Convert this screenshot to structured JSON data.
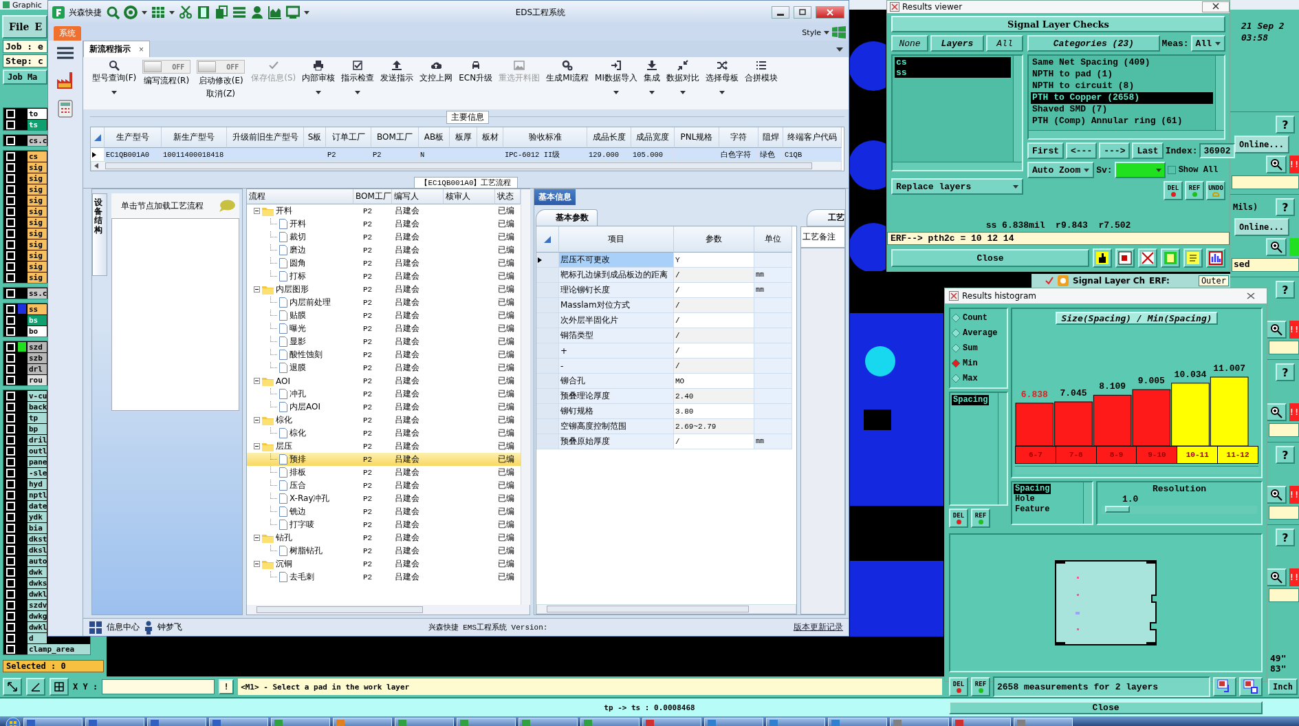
{
  "desktop": {
    "title": "Graphic",
    "menu": [
      "File",
      "E"
    ],
    "job": "Job : e",
    "step": "Step: c",
    "job_matrix": "Job Ma",
    "layer_groups": [
      {
        "layers": [
          {
            "name": "to",
            "color": "#ffffff",
            "checked": false
          },
          {
            "name": "ts",
            "color": "#10a070",
            "checked": false
          }
        ]
      },
      {
        "layers": [
          {
            "name": "cs.c",
            "color": "#c8c8c8",
            "checked": false
          }
        ]
      },
      {
        "layers": [
          {
            "name": "cs",
            "color": "#f8c060",
            "checked": false
          },
          {
            "name": "sig",
            "color": "#f8c060",
            "checked": false
          },
          {
            "name": "sig",
            "color": "#f8c060",
            "checked": false
          },
          {
            "name": "sig",
            "color": "#f8c060",
            "checked": false
          },
          {
            "name": "sig",
            "color": "#f8c060",
            "checked": false
          },
          {
            "name": "sig",
            "color": "#f8c060",
            "checked": false
          },
          {
            "name": "sig",
            "color": "#f8c060",
            "checked": false
          },
          {
            "name": "sig",
            "color": "#f8c060",
            "checked": false
          },
          {
            "name": "sig",
            "color": "#f8c060",
            "checked": false
          },
          {
            "name": "sig",
            "color": "#f8c060",
            "checked": false
          },
          {
            "name": "sig",
            "color": "#f8c060",
            "checked": false
          },
          {
            "name": "sig",
            "color": "#f8c060",
            "checked": false
          }
        ]
      },
      {
        "layers": [
          {
            "name": "ss.c",
            "color": "#c8c8c8",
            "checked": false
          }
        ]
      },
      {
        "layers": [
          {
            "name": "ss",
            "color": "#f8c060",
            "checked": false,
            "swatch": {
              "color": "#2030e0"
            }
          },
          {
            "name": "bs",
            "color": "#10a070",
            "checked": false
          },
          {
            "name": "bo",
            "color": "#ffffff",
            "checked": false
          }
        ]
      },
      {
        "layers": [
          {
            "name": "szd",
            "color": "#b8b8b8",
            "checked": false,
            "swatch": {
              "color": "#20e020"
            }
          },
          {
            "name": "szb",
            "color": "#b8b8b8",
            "checked": false
          },
          {
            "name": "drl",
            "color": "#b8b8b8",
            "checked": false
          },
          {
            "name": "rou",
            "color": "#e0e0e0",
            "checked": false
          }
        ]
      },
      {
        "layers": [
          {
            "name": "v-cu",
            "color": "#a8dcd4",
            "checked": false
          },
          {
            "name": "back",
            "color": "#a8dcd4",
            "checked": false
          },
          {
            "name": "tp",
            "color": "#a8dcd4",
            "checked": false
          },
          {
            "name": "bp",
            "color": "#a8dcd4",
            "checked": false
          },
          {
            "name": "dril",
            "color": "#a8dcd4",
            "checked": false
          },
          {
            "name": "outl",
            "color": "#a8dcd4",
            "checked": false
          },
          {
            "name": "pane",
            "color": "#a8dcd4",
            "checked": false
          },
          {
            "name": "-sle",
            "color": "#a8dcd4",
            "checked": false
          },
          {
            "name": "hyd",
            "color": "#a8dcd4",
            "checked": false
          },
          {
            "name": "nptl",
            "color": "#a8dcd4",
            "checked": false
          },
          {
            "name": "date",
            "color": "#a8dcd4",
            "checked": false
          },
          {
            "name": "ydk",
            "color": "#a8dcd4",
            "checked": false
          },
          {
            "name": "bia",
            "color": "#a8dcd4",
            "checked": false
          },
          {
            "name": "dkst",
            "color": "#a8dcd4",
            "checked": false
          },
          {
            "name": "dksl",
            "color": "#a8dcd4",
            "checked": false
          },
          {
            "name": "auto",
            "color": "#a8dcd4",
            "checked": false
          },
          {
            "name": "dwk",
            "color": "#a8dcd4",
            "checked": false
          },
          {
            "name": "dwks",
            "color": "#a8dcd4",
            "checked": false
          },
          {
            "name": "dwkl",
            "color": "#a8dcd4",
            "checked": false
          },
          {
            "name": "szdv",
            "color": "#a8dcd4",
            "checked": false
          },
          {
            "name": "dwkg",
            "color": "#a8dcd4",
            "checked": false
          },
          {
            "name": "dwkl",
            "color": "#a8dcd4",
            "checked": false
          },
          {
            "name": "d",
            "color": "#a8dcd4",
            "checked": false
          },
          {
            "name": "clamp_area",
            "color": "#a8dcd4",
            "checked": false
          }
        ]
      }
    ],
    "selected_count": "Selected : 0",
    "xy_label": "X Y :",
    "alert_button": "!",
    "prompt": "<M1> - Select a pad in the work layer",
    "units": "Inch",
    "status": "tp -> ts : 0.0008468",
    "clock": {
      "date": "21 Sep 2",
      "time": "03:58"
    },
    "check_blocks": [
      {
        "help": "?",
        "online": "Online...",
        "status": {
          "color": "#ff2020",
          "text": "!!"
        }
      },
      {
        "help": "?",
        "note": "Mils)",
        "online": "Online...",
        "status": {
          "color": "#20e020"
        },
        "field": "sed"
      },
      {
        "help": "?",
        "status": {
          "color": "#ff2020",
          "text": "!!"
        }
      },
      {
        "help": "?",
        "status": {
          "color": "#ff2020",
          "text": "!!"
        }
      },
      {
        "help": "?",
        "status": {
          "color": "#ff2020",
          "text": "!!"
        }
      },
      {
        "help": "?",
        "status": {
          "color": "#ff2020",
          "text": "!!"
        }
      }
    ],
    "coords": [
      "49\"",
      "83\""
    ],
    "behind_window": {
      "title": "Signal Layer Ch",
      "checked": true,
      "erf_label": "ERF:",
      "erf_value": "Outer"
    },
    "taskbar": [
      {
        "color": "#3060c0"
      },
      {
        "color": "#3060c0"
      },
      {
        "color": "#3060c0"
      },
      {
        "color": "#3060c0"
      },
      {
        "color": "#30a040"
      },
      {
        "color": "#e08020"
      },
      {
        "color": "#30a040"
      },
      {
        "color": "#30a040"
      },
      {
        "color": "#30a040"
      },
      {
        "color": "#30a040"
      },
      {
        "color": "#d03030"
      },
      {
        "color": "#3080d0"
      },
      {
        "color": "#3080d0"
      },
      {
        "color": "#3080d0"
      },
      {
        "color": "#808080"
      },
      {
        "color": "#d03030"
      },
      {
        "color": "#808080"
      }
    ]
  },
  "eds_window": {
    "app_name": "兴森快捷",
    "title": "EDS工程系统",
    "menu_tab": "系统",
    "style_label": "Style",
    "document_tab": {
      "label": "新流程指示",
      "close": "×"
    },
    "toolbar": [
      {
        "label": "型号查询(F)",
        "kind": "button",
        "dropdown": true,
        "disabled": false
      },
      {
        "label": "编写流程(R)",
        "kind": "toggle",
        "switch": "OFF",
        "on": false
      },
      {
        "label": "启动修改(E)",
        "sublabel": "取消(Z)",
        "kind": "toggle",
        "switch": "OFF",
        "on": false
      },
      {
        "label": "保存信息(S)",
        "kind": "button",
        "dropdown": false,
        "disabled": true
      },
      {
        "label": "内部审核",
        "kind": "button",
        "dropdown": true,
        "disabled": false
      },
      {
        "label": "指示检查",
        "kind": "button",
        "dropdown": true,
        "disabled": false
      },
      {
        "label": "发送指示",
        "kind": "button",
        "dropdown": false,
        "disabled": false
      },
      {
        "label": "文控上网",
        "kind": "button",
        "dropdown": false,
        "disabled": false
      },
      {
        "label": "ECN升级",
        "kind": "button",
        "dropdown": false,
        "disabled": false
      },
      {
        "label": "重选开料图",
        "kind": "button",
        "dropdown": false,
        "disabled": true
      },
      {
        "label": "生成MI流程",
        "kind": "button",
        "dropdown": false,
        "disabled": false
      },
      {
        "label": "MI数据导入",
        "kind": "button",
        "dropdown": true,
        "disabled": false
      },
      {
        "label": "集成",
        "kind": "button",
        "dropdown": true,
        "disabled": false
      },
      {
        "label": "数据对比",
        "kind": "button",
        "dropdown": true,
        "disabled": false
      },
      {
        "label": "选择母板",
        "kind": "button",
        "dropdown": true,
        "disabled": false
      },
      {
        "label": "合拼模块",
        "kind": "button",
        "dropdown": false,
        "disabled": false
      }
    ],
    "main_info": {
      "caption": "主要信息",
      "columns": [
        "生产型号",
        "新生产型号",
        "升级前旧生产型号",
        "S板",
        "订单工厂",
        "BOM工厂",
        "AB板",
        "板厚",
        "板材",
        "验收标准",
        "成品长度",
        "成品宽度",
        "PNL规格",
        "字符",
        "阻焊",
        "终端客户代码"
      ],
      "rows": [
        {
          "selected": true,
          "cells": [
            "EC1QB001A0",
            "10011400018418",
            null,
            null,
            "P2",
            "P2",
            "N",
            null,
            null,
            "IPC-6012 II级",
            "129.000",
            "105.000",
            null,
            "白色字符",
            "绿色",
            "C1QB"
          ]
        }
      ]
    },
    "process_caption": "【EC1QB001A0】工艺流程",
    "side_panel": {
      "tab": "设备结构",
      "hint": "单击节点加载工艺流程"
    },
    "process_tree": {
      "columns": [
        "流程",
        "BOM工厂",
        "编写人",
        "核审人",
        "状态"
      ],
      "rows": [
        {
          "label": "开料",
          "bom": "P2",
          "author": "吕建会",
          "status": "已编",
          "selected": false,
          "expanded": true,
          "children": [
            {
              "label": "开料",
              "bom": "P2",
              "author": "吕建会",
              "status": "已编",
              "selected": false
            },
            {
              "label": "裁切",
              "bom": "P2",
              "author": "吕建会",
              "status": "已编",
              "selected": false
            },
            {
              "label": "磨边",
              "bom": "P2",
              "author": "吕建会",
              "status": "已编",
              "selected": false
            },
            {
              "label": "圆角",
              "bom": "P2",
              "author": "吕建会",
              "status": "已编",
              "selected": false
            },
            {
              "label": "打标",
              "bom": "P2",
              "author": "吕建会",
              "status": "已编",
              "selected": false
            }
          ]
        },
        {
          "label": "内层图形",
          "bom": "P2",
          "author": "吕建会",
          "status": "已编",
          "selected": false,
          "expanded": true,
          "children": [
            {
              "label": "内层前处理",
              "bom": "P2",
              "author": "吕建会",
              "status": "已编",
              "selected": false
            },
            {
              "label": "贴膜",
              "bom": "P2",
              "author": "吕建会",
              "status": "已编",
              "selected": false
            },
            {
              "label": "曝光",
              "bom": "P2",
              "author": "吕建会",
              "status": "已编",
              "selected": false
            },
            {
              "label": "显影",
              "bom": "P2",
              "author": "吕建会",
              "status": "已编",
              "selected": false
            },
            {
              "label": "酸性蚀刻",
              "bom": "P2",
              "author": "吕建会",
              "status": "已编",
              "selected": false
            },
            {
              "label": "退膜",
              "bom": "P2",
              "author": "吕建会",
              "status": "已编",
              "selected": false
            }
          ]
        },
        {
          "label": "AOI",
          "bom": "P2",
          "author": "吕建会",
          "status": "已编",
          "selected": false,
          "expanded": true,
          "children": [
            {
              "label": "冲孔",
              "bom": "P2",
              "author": "吕建会",
              "status": "已编",
              "selected": false
            },
            {
              "label": "内层AOI",
              "bom": "P2",
              "author": "吕建会",
              "status": "已编",
              "selected": false
            }
          ]
        },
        {
          "label": "棕化",
          "bom": "P2",
          "author": "吕建会",
          "status": "已编",
          "selected": false,
          "expanded": true,
          "children": [
            {
              "label": "棕化",
              "bom": "P2",
              "author": "吕建会",
              "status": "已编",
              "selected": false
            }
          ]
        },
        {
          "label": "层压",
          "bom": "P2",
          "author": "吕建会",
          "status": "已编",
          "selected": false,
          "expanded": true,
          "children": [
            {
              "label": "预排",
              "bom": "P2",
              "author": "吕建会",
              "status": "已编",
              "selected": true
            },
            {
              "label": "排板",
              "bom": "P2",
              "author": "吕建会",
              "status": "已编",
              "selected": false
            },
            {
              "label": "压合",
              "bom": "P2",
              "author": "吕建会",
              "status": "已编",
              "selected": false
            },
            {
              "label": "X-Ray冲孔",
              "bom": "P2",
              "author": "吕建会",
              "status": "已编",
              "selected": false
            },
            {
              "label": "铣边",
              "bom": "P2",
              "author": "吕建会",
              "status": "已编",
              "selected": false
            },
            {
              "label": "打字唛",
              "bom": "P2",
              "author": "吕建会",
              "status": "已编",
              "selected": false
            }
          ]
        },
        {
          "label": "钻孔",
          "bom": "P2",
          "author": "吕建会",
          "status": "已编",
          "selected": false,
          "expanded": true,
          "children": [
            {
              "label": "树脂钻孔",
              "bom": "P2",
              "author": "吕建会",
              "status": "已编",
              "selected": false
            }
          ]
        },
        {
          "label": "沉铜",
          "bom": "P2",
          "author": "吕建会",
          "status": "已编",
          "selected": false,
          "expanded": true,
          "children": [
            {
              "label": "去毛刺",
              "bom": "P2",
              "author": "吕建会",
              "status": "已编",
              "selected": false
            }
          ]
        }
      ]
    },
    "info_tab": {
      "label": "基本信息",
      "selected": true
    },
    "params": {
      "tab": "基本参数",
      "columns": [
        "项目",
        "参数",
        "单位"
      ],
      "rows": [
        {
          "item": "层压不可更改",
          "value": "Y",
          "selected": true
        },
        {
          "item": "靶标孔边缘到成品板边的距离",
          "value": "/",
          "unit": "mm",
          "selected": false
        },
        {
          "item": "理论铆钉长度",
          "value": "/",
          "unit": "mm",
          "selected": false
        },
        {
          "item": "Masslam对位方式",
          "value": "/",
          "selected": false
        },
        {
          "item": "次外层半固化片",
          "value": "/",
          "selected": false
        },
        {
          "item": "铜箔类型",
          "value": "/",
          "selected": false
        },
        {
          "item": "+",
          "value": "/",
          "selected": false
        },
        {
          "item": "-",
          "value": "/",
          "selected": false
        },
        {
          "item": "铆合孔",
          "value": "MO",
          "selected": false
        },
        {
          "item": "预叠理论厚度",
          "value": "2.40",
          "selected": false
        },
        {
          "item": "铆钉规格",
          "value": "3.80",
          "selected": false
        },
        {
          "item": "空铆高度控制范围",
          "value": "2.69~2.79",
          "selected": false
        },
        {
          "item": "预叠原始厚度",
          "value": "/",
          "unit": "mm",
          "selected": false
        }
      ]
    },
    "notes": {
      "tab": "工艺",
      "label": "工艺备注"
    },
    "status": {
      "info_center": "信息中心",
      "user": "钟梦飞",
      "product": "兴森快捷 EMS工程系统 Version:",
      "changelog": "版本更新记录"
    }
  },
  "results_viewer": {
    "title": "Results viewer",
    "heading": "Signal Layer Checks",
    "layer_modes": [
      {
        "label": "None",
        "selected": false
      },
      {
        "label": "Layers",
        "selected": true
      },
      {
        "label": "All",
        "selected": false
      }
    ],
    "categories_label": "Categories (23)",
    "meas_label": "Meas:",
    "meas_value": "All",
    "layers": [
      {
        "name": "cs",
        "selected": true
      },
      {
        "name": "ss",
        "selected": true
      }
    ],
    "categories": [
      {
        "label": "Same Net Spacing (409)",
        "selected": false
      },
      {
        "label": "NPTH to pad (1)",
        "selected": false
      },
      {
        "label": "NPTH to circuit (8)",
        "selected": false
      },
      {
        "label": "PTH to Copper (2658)",
        "selected": true
      },
      {
        "label": "Shaved SMD (7)",
        "selected": false
      },
      {
        "label": "PTH (Comp) Annular ring (61)",
        "selected": false
      }
    ],
    "nav": [
      "First",
      "<---",
      "--->",
      "Last"
    ],
    "index_label": "Index:",
    "index_value": "36902",
    "auto_zoom": "Auto Zoom",
    "sv_label": "Sv:",
    "show_all": {
      "label": "Show All",
      "checked": false
    },
    "replace_layers": "Replace layers",
    "tools": [
      {
        "label": "DEL",
        "kind": "delete"
      },
      {
        "label": "REF",
        "kind": "refresh"
      },
      {
        "label": "UNDO",
        "kind": "undo"
      }
    ],
    "measurement": "ss 6.838mil  r9.843  r7.502",
    "erf": "ERF--> pth2c = 10 12 14",
    "close": "Close"
  },
  "results_histogram": {
    "title": "Results histogram",
    "modes": [
      {
        "label": "Count",
        "selected": false
      },
      {
        "label": "Average",
        "selected": false
      },
      {
        "label": "Sum",
        "selected": false
      },
      {
        "label": "Min",
        "selected": true
      },
      {
        "label": "Max",
        "selected": false
      }
    ],
    "measures": [
      {
        "label": "Spacing",
        "selected": true
      }
    ],
    "tools": [
      {
        "label": "DEL",
        "kind": "delete"
      },
      {
        "label": "REF",
        "kind": "refresh"
      }
    ],
    "chart_data": {
      "type": "bar",
      "title": "Size(Spacing) / Min(Spacing)",
      "categories": [
        "6-7",
        "7-8",
        "8-9",
        "9-10",
        "10-11",
        "11-12"
      ],
      "series": [
        {
          "color": "#ff1a1a",
          "values": [
            6.838,
            7.045,
            8.109,
            9.005,
            null,
            null
          ]
        },
        {
          "color": "#ffff00",
          "values": [
            null,
            null,
            null,
            null,
            10.034,
            11.007
          ]
        }
      ],
      "stacked": true,
      "data_labels": true
    },
    "types": [
      {
        "label": "Spacing",
        "selected": true
      },
      {
        "label": "Hole",
        "selected": false
      },
      {
        "label": "Feature",
        "selected": false
      }
    ],
    "resolution": {
      "label": "Resolution",
      "reading": "1.0",
      "level": 0.1
    },
    "bottom_tools": [
      {
        "label": "DEL",
        "kind": "delete"
      },
      {
        "label": "REF",
        "kind": "refresh"
      }
    ],
    "summary": "2658 measurements for 2 layers",
    "close": "Close"
  }
}
